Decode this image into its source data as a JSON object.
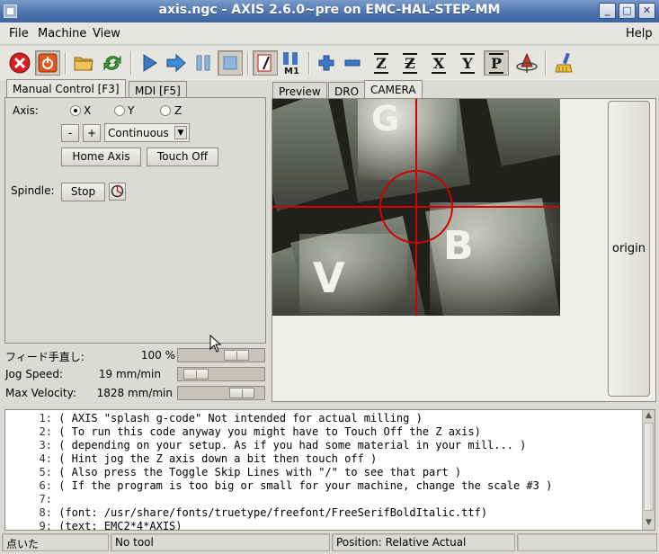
{
  "window": {
    "title": "axis.ngc - AXIS 2.6.0~pre on EMC-HAL-STEP-MM"
  },
  "menubar": {
    "file": "File",
    "machine": "Machine",
    "view": "View",
    "help": "Help"
  },
  "toolbar": {
    "icons": [
      "estop-icon",
      "power-icon",
      "open-folder-icon",
      "reload-icon",
      "run-icon",
      "step-icon",
      "pause-icon",
      "stop-icon",
      "block-delete-icon",
      "optional-stop-icon",
      "zoom-in-icon",
      "zoom-out-icon",
      "view-z-icon",
      "view-z2-icon",
      "view-x-icon",
      "view-y-icon",
      "view-p-icon",
      "rotate-icon",
      "clear-plot-icon"
    ],
    "m1_label": "M1",
    "view_z": "Z",
    "view_z2": "Z",
    "view_x": "X",
    "view_y": "Y",
    "view_p": "P"
  },
  "left_tabs": {
    "manual": "Manual Control [F3]",
    "mdi": "MDI [F5]"
  },
  "manual": {
    "axis_label": "Axis:",
    "axes": [
      "X",
      "Y",
      "Z"
    ],
    "selected_axis": "X",
    "minus": "-",
    "plus": "+",
    "jog_mode": "Continuous",
    "home_axis": "Home Axis",
    "touch_off": "Touch Off",
    "spindle_label": "Spindle:",
    "spindle_stop": "Stop"
  },
  "sliders": {
    "feed_override": {
      "label": "フィード手直し:",
      "value": "100 %",
      "level": 0.75
    },
    "jog_speed": {
      "label": "Jog Speed:",
      "value": "19 mm/min",
      "level": 0.08
    },
    "max_velocity": {
      "label": "Max Velocity:",
      "value": "1828 mm/min",
      "level": 0.85
    }
  },
  "right_tabs": {
    "preview": "Preview",
    "dro": "DRO",
    "camera": "CAMERA"
  },
  "camera": {
    "origin_button": "origin",
    "key_letters": [
      "G",
      "B",
      "V"
    ],
    "crosshair_color": "#d40000"
  },
  "code": {
    "lines": [
      {
        "num": "1:",
        "text": "( AXIS \"splash g-code\" Not intended for actual milling )"
      },
      {
        "num": "2:",
        "text": "( To run this code anyway you might have to Touch Off the Z axis)"
      },
      {
        "num": "3:",
        "text": "( depending on your setup. As if you had some material in your mill... )"
      },
      {
        "num": "4:",
        "text": "( Hint jog the Z axis down a bit then touch off )"
      },
      {
        "num": "5:",
        "text": "( Also press the Toggle Skip Lines with \"/\" to see that part )"
      },
      {
        "num": "6:",
        "text": "( If the program is too big or small for your machine, change the scale #3 )"
      },
      {
        "num": "7:",
        "text": ""
      },
      {
        "num": "8:",
        "text": "(font: /usr/share/fonts/truetype/freefont/FreeSerifBoldItalic.ttf)"
      },
      {
        "num": "9:",
        "text": "(text: EMC2*4*AXIS)"
      }
    ]
  },
  "statusbar": {
    "machine_state": "点いた",
    "tool": "No tool",
    "position": "Position: Relative Actual"
  }
}
